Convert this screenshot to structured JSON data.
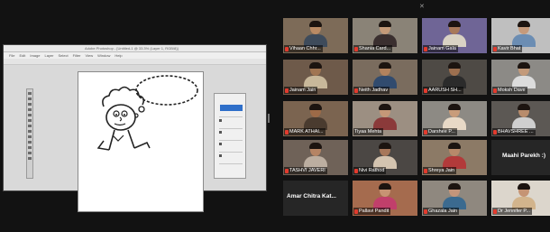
{
  "shared_screen": {
    "title": "Adobe Photoshop - [Untitled-1 @ 33.3% (Layer 1, RGB/8)]",
    "menus": [
      "File",
      "Edit",
      "Image",
      "Layer",
      "Select",
      "Filter",
      "View",
      "Window",
      "Help"
    ]
  },
  "participants": [
    {
      "name": "Vihaan Chhr...",
      "muted": true,
      "bg": "#7d6b58",
      "skin": "#b98a64",
      "shirt": "#3e4b5b"
    },
    {
      "name": "Shania Card...",
      "muted": true,
      "bg": "#8a8377",
      "skin": "#c49a78",
      "shirt": "#3a2f2f"
    },
    {
      "name": "Jainam Gala",
      "muted": true,
      "bg": "#6f6596",
      "skin": "#a8795a",
      "shirt": "#d9d2c4"
    },
    {
      "name": "Kavir Bhat",
      "muted": true,
      "bg": "#bfbfbf",
      "skin": "#c59a7b",
      "shirt": "#6b8db3"
    },
    {
      "name": "Jainam Jain",
      "muted": true,
      "bg": "#6e5a4a",
      "skin": "#a07552",
      "shirt": "#c8b89a"
    },
    {
      "name": "Neith Jadhav",
      "muted": true,
      "bg": "#7a6c5e",
      "skin": "#b2825d",
      "shirt": "#314b6e"
    },
    {
      "name": "AARUSH SH...",
      "muted": true,
      "bg": "#4e4a45",
      "skin": "#9c6f4f",
      "shirt": "#2b2b2b"
    },
    {
      "name": "Moksh Dave",
      "muted": true,
      "bg": "#8c8a86",
      "skin": "#c39a7a",
      "shirt": "#dcdcdc"
    },
    {
      "name": "MARK ATHAI...",
      "muted": true,
      "bg": "#7b6450",
      "skin": "#9d6a47",
      "shirt": "#4a3b2f"
    },
    {
      "name": "Tiyaa Mehta",
      "muted": false,
      "bg": "#9c8f82",
      "skin": "#c59878",
      "shirt": "#8b3a3a"
    },
    {
      "name": "Darshee P...",
      "muted": true,
      "bg": "#8d8a84",
      "skin": "#c89c7a",
      "shirt": "#e8d9c6"
    },
    {
      "name": "BHAVSHREE ...",
      "muted": true,
      "bg": "#5c5854",
      "skin": "#b88c6c",
      "shirt": "#cfcfcf"
    },
    {
      "name": "TASHVI JAVERI",
      "muted": true,
      "bg": "#6f6258",
      "skin": "#b58464",
      "shirt": "#bcaea0"
    },
    {
      "name": "Nivi Rathod",
      "muted": true,
      "bg": "#4b4744",
      "skin": "#a7775a",
      "shirt": "#d4c4b0"
    },
    {
      "name": "Shreya Jain",
      "muted": true,
      "bg": "#8c7a66",
      "skin": "#b7896a",
      "shirt": "#b23a3a"
    },
    {
      "name": "Maahi Parekh :)",
      "muted": false,
      "bg": "#262626",
      "skin": "",
      "shirt": "",
      "text_only": true
    },
    {
      "name": "Amar Chitra Kat...",
      "muted": false,
      "bg": "#262626",
      "skin": "",
      "shirt": "",
      "text_only": true
    },
    {
      "name": "Pallavi Pandit",
      "muted": true,
      "bg": "#a56b4e",
      "skin": "#c79373",
      "shirt": "#c13f6b"
    },
    {
      "name": "Ghazala Jain",
      "muted": true,
      "bg": "#8f887f",
      "skin": "#c4957a",
      "shirt": "#3b6a8f"
    },
    {
      "name": "Dr Jennifer P...",
      "muted": true,
      "bg": "#dcd6cc",
      "skin": "#c59474",
      "shirt": "#d2b48c"
    }
  ]
}
